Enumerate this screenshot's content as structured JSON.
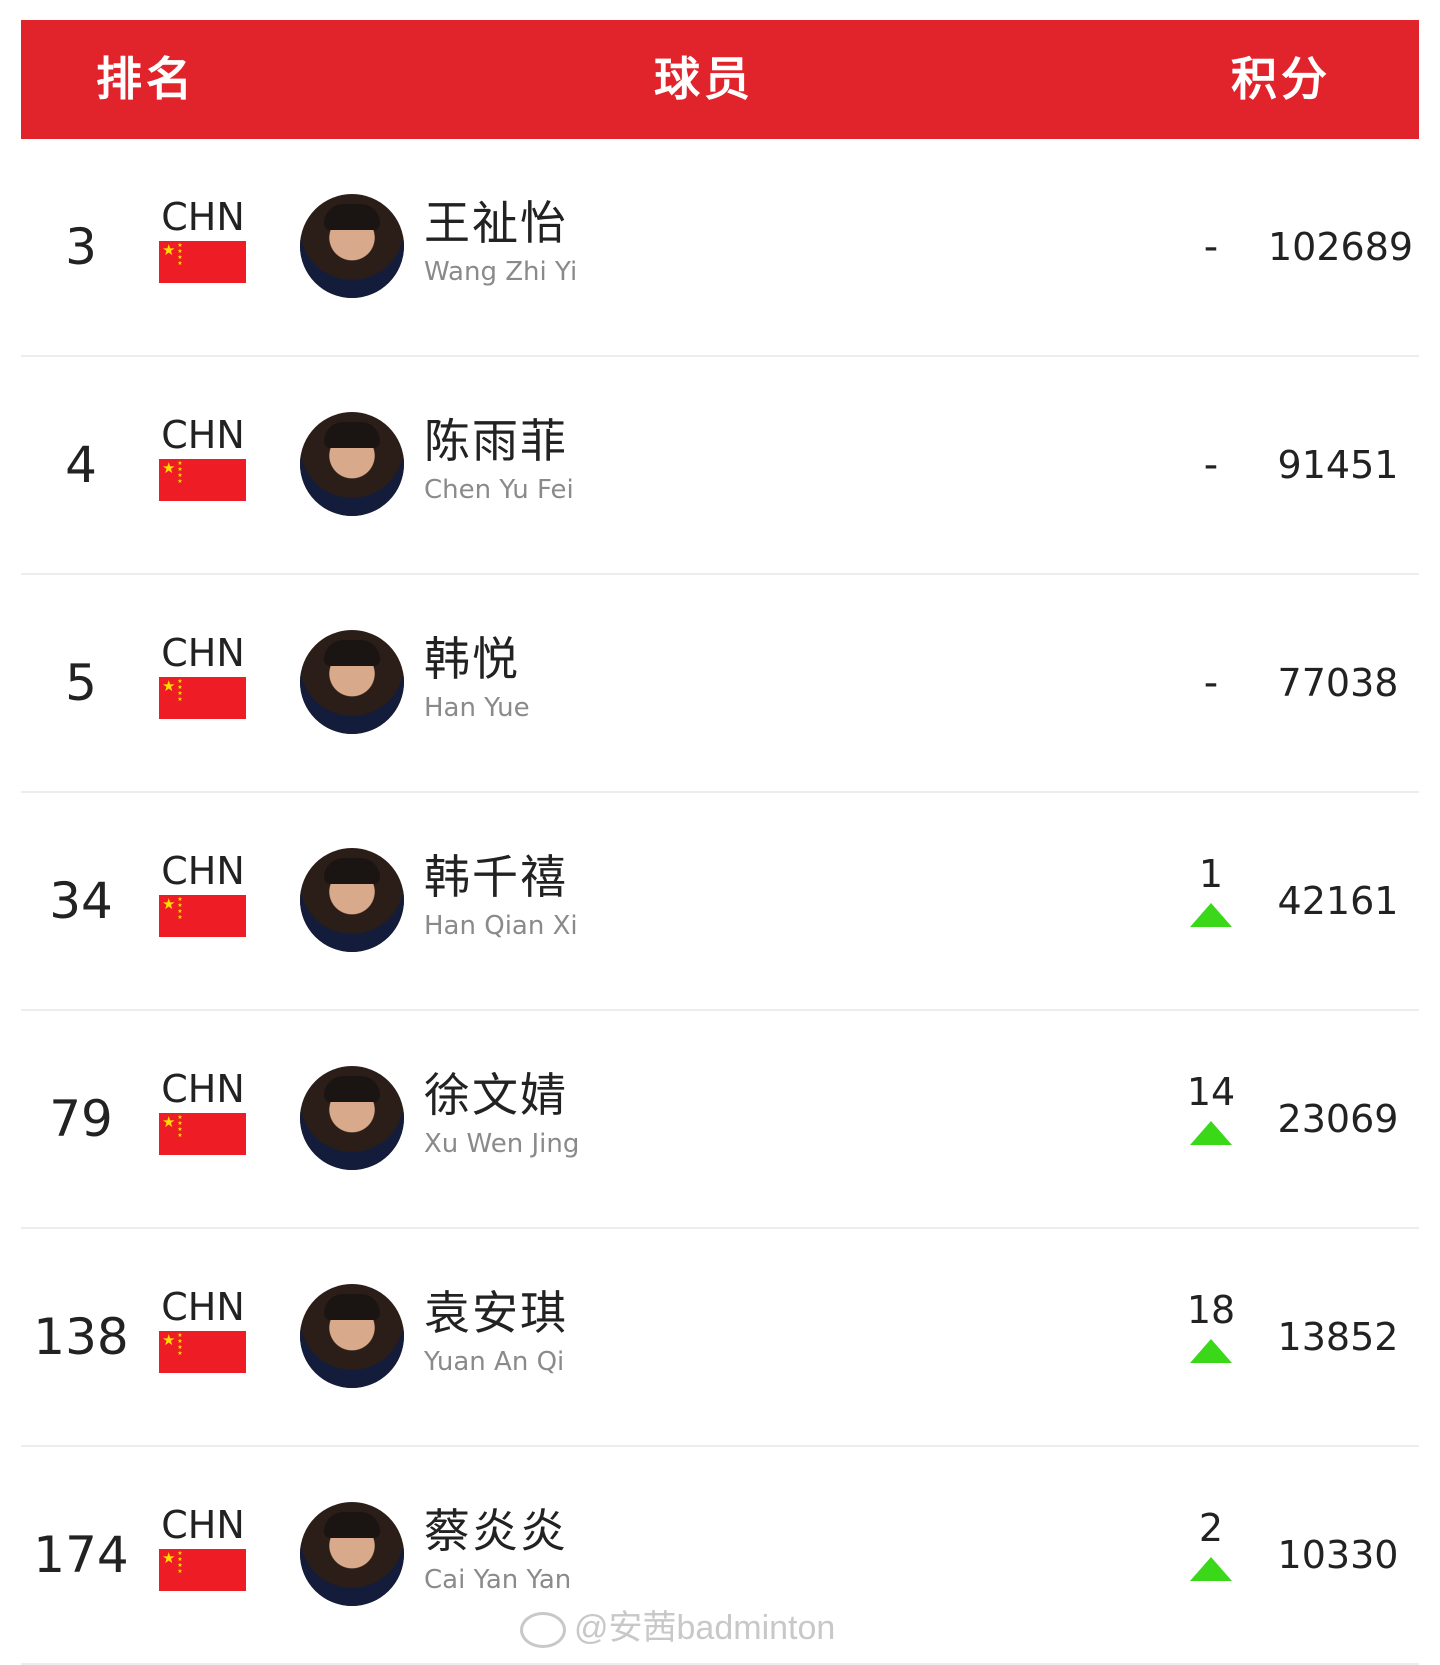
{
  "header": {
    "rank_label": "排名",
    "player_label": "球员",
    "points_label": "积分"
  },
  "players": [
    {
      "rank": "3",
      "country": "CHN",
      "name_cn": "王祉怡",
      "name_en": "Wang Zhi Yi",
      "change": "-",
      "trend": "same",
      "points": "102689"
    },
    {
      "rank": "4",
      "country": "CHN",
      "name_cn": "陈雨菲",
      "name_en": "Chen Yu Fei",
      "change": "-",
      "trend": "same",
      "points": "91451"
    },
    {
      "rank": "5",
      "country": "CHN",
      "name_cn": "韩悦",
      "name_en": "Han Yue",
      "change": "-",
      "trend": "same",
      "points": "77038"
    },
    {
      "rank": "34",
      "country": "CHN",
      "name_cn": "韩千禧",
      "name_en": "Han Qian Xi",
      "change": "1",
      "trend": "up",
      "points": "42161"
    },
    {
      "rank": "79",
      "country": "CHN",
      "name_cn": "徐文婧",
      "name_en": "Xu Wen Jing",
      "change": "14",
      "trend": "up",
      "points": "23069"
    },
    {
      "rank": "138",
      "country": "CHN",
      "name_cn": "袁安琪",
      "name_en": "Yuan An Qi",
      "change": "18",
      "trend": "up",
      "points": "13852"
    },
    {
      "rank": "174",
      "country": "CHN",
      "name_cn": "蔡炎炎",
      "name_en": "Cai Yan Yan",
      "change": "2",
      "trend": "up",
      "points": "10330"
    }
  ],
  "watermark": "@安茜badminton",
  "colors": {
    "header_bg": "#e1232b",
    "up_arrow": "#3bd81a",
    "flag_red": "#ee1c25",
    "flag_star": "#ffde00"
  },
  "icons": {
    "flag": "china-flag-icon",
    "trend_up": "up-arrow-icon"
  }
}
